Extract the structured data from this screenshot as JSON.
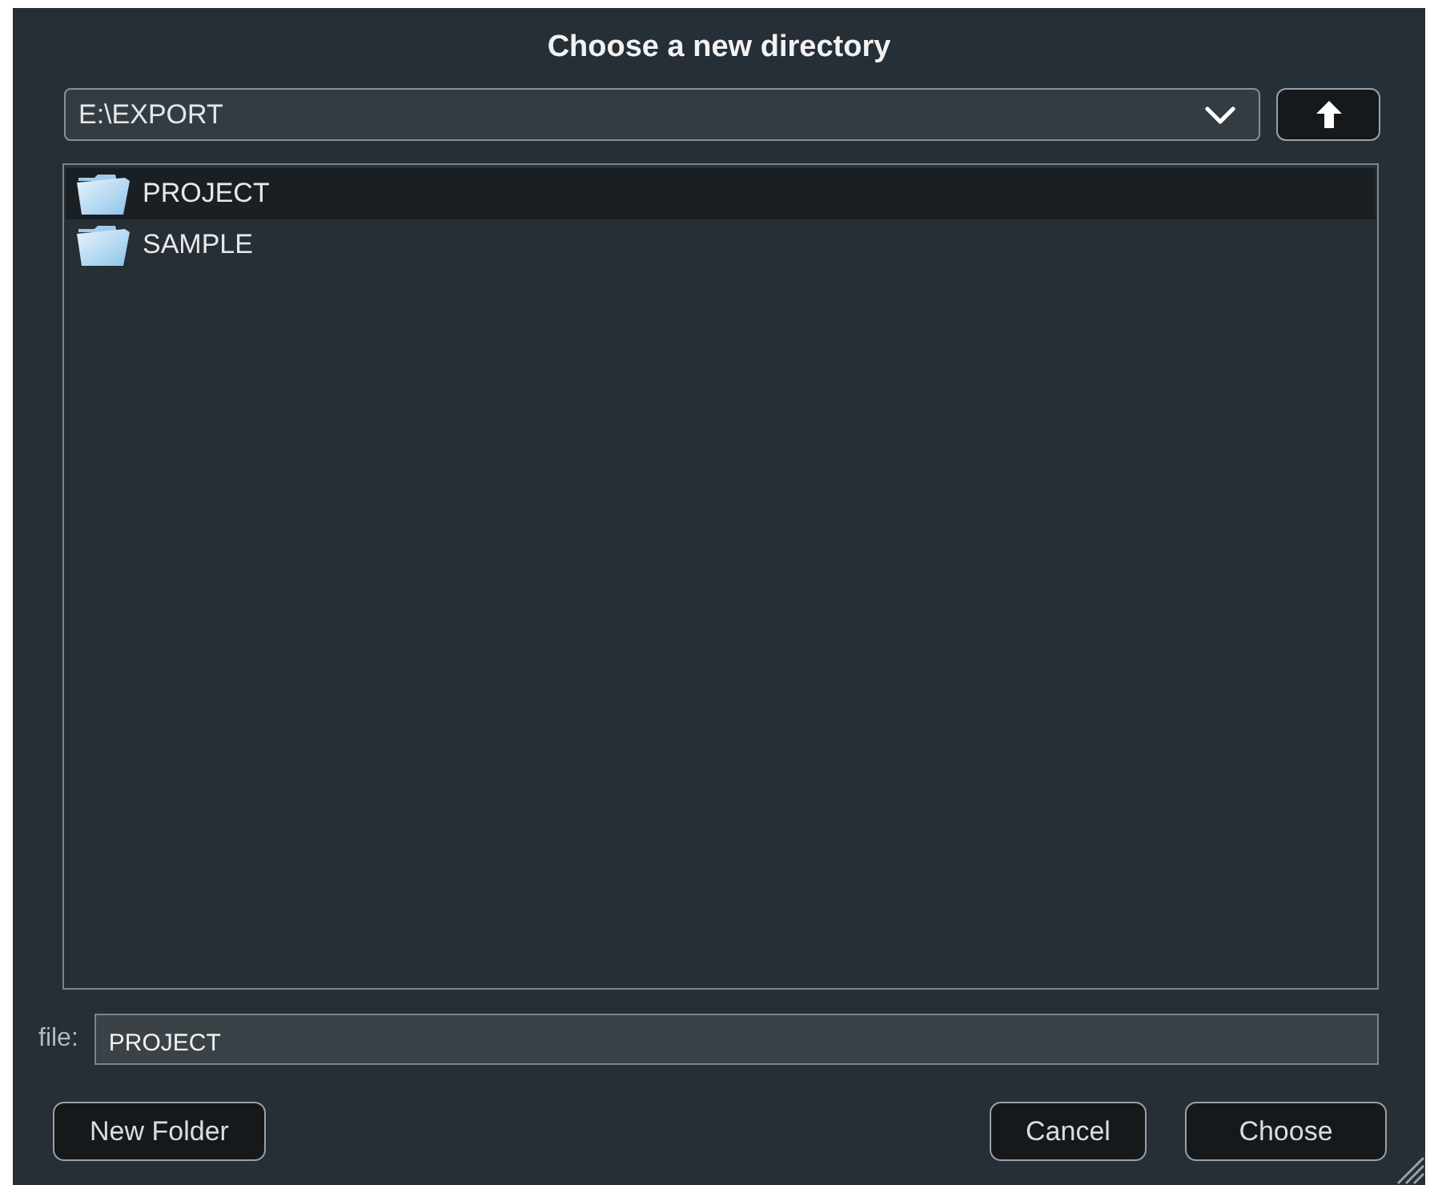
{
  "dialog": {
    "title": "Choose a new directory"
  },
  "path_dropdown": {
    "value": "E:\\EXPORT"
  },
  "folders": [
    {
      "name": "PROJECT",
      "selected": true
    },
    {
      "name": "SAMPLE",
      "selected": false
    }
  ],
  "file_field": {
    "label": "file:",
    "value": "PROJECT"
  },
  "left_buttons": [
    "New Folder"
  ],
  "right_buttons": [
    "Cancel",
    "Choose"
  ]
}
